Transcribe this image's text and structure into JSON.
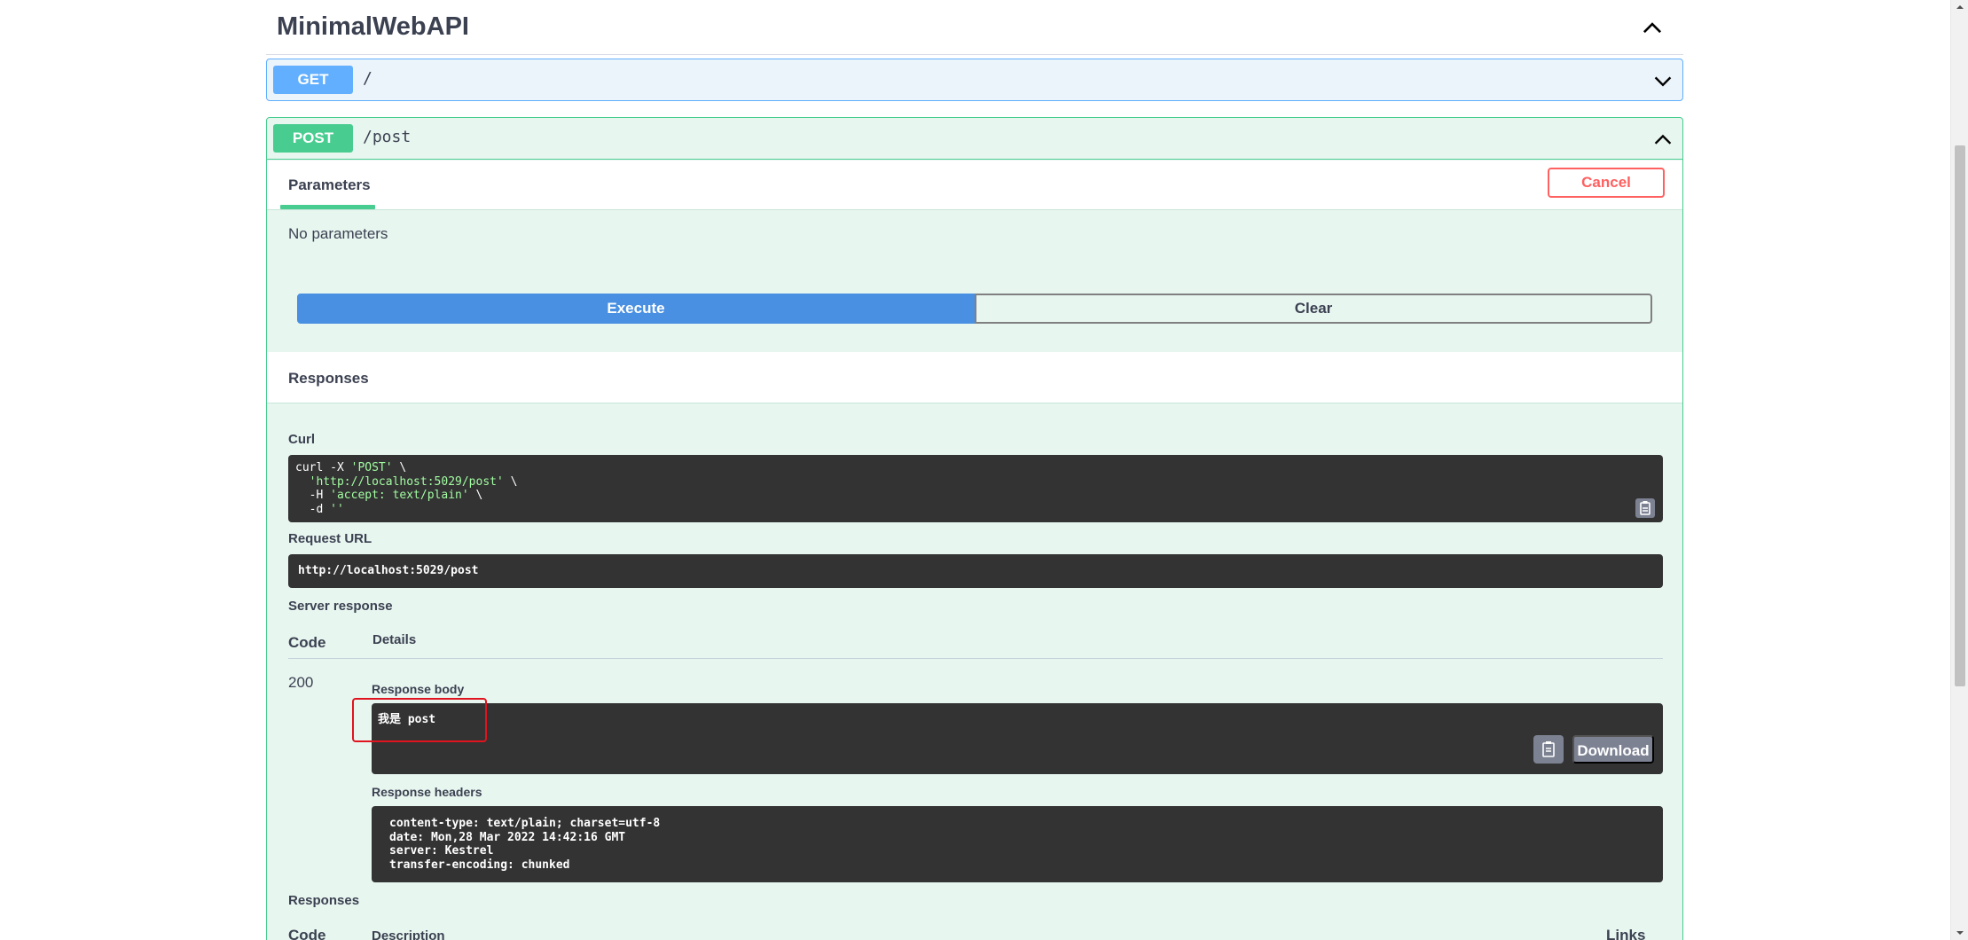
{
  "tag": {
    "title": "MinimalWebAPI"
  },
  "operations": {
    "get": {
      "method": "GET",
      "path": "/"
    },
    "post": {
      "method": "POST",
      "path": "/post"
    }
  },
  "parameters": {
    "tab_label": "Parameters",
    "cancel_label": "Cancel",
    "empty_text": "No parameters"
  },
  "actions": {
    "execute_label": "Execute",
    "clear_label": "Clear"
  },
  "responses": {
    "title": "Responses",
    "curl_label": "Curl",
    "curl_lines": [
      {
        "prefix": "curl -X ",
        "str": "'POST'",
        "suffix": " \\"
      },
      {
        "prefix": "  ",
        "str": "'http://localhost:5029/post'",
        "suffix": " \\"
      },
      {
        "prefix": "  -H ",
        "str": "'accept: text/plain'",
        "suffix": " \\"
      },
      {
        "prefix": "  -d ",
        "str": "''",
        "suffix": ""
      }
    ],
    "request_url_label": "Request URL",
    "request_url": "http://localhost:5029/post",
    "server_response_label": "Server response",
    "col_code": "Code",
    "col_details": "Details",
    "status_code": "200",
    "body_label": "Response body",
    "body": "我是 post",
    "download_label": "Download",
    "headers_label": "Response headers",
    "headers_lines": [
      "content-type: text/plain; charset=utf-8",
      "date: Mon,28 Mar 2022 14:42:16 GMT",
      "server: Kestrel",
      "transfer-encoding: chunked"
    ],
    "footer_title": "Responses",
    "footer_col_code": "Code",
    "footer_col_description": "Description",
    "footer_col_links": "Links"
  },
  "colors": {
    "get": "#61affe",
    "post": "#49cc90",
    "execute": "#4990e2",
    "cancel": "#ff6060",
    "highlight": "#e0141e"
  },
  "icons": {
    "collapse": "chevron-up-icon",
    "expand": "chevron-down-icon",
    "copy": "clipboard-icon"
  }
}
